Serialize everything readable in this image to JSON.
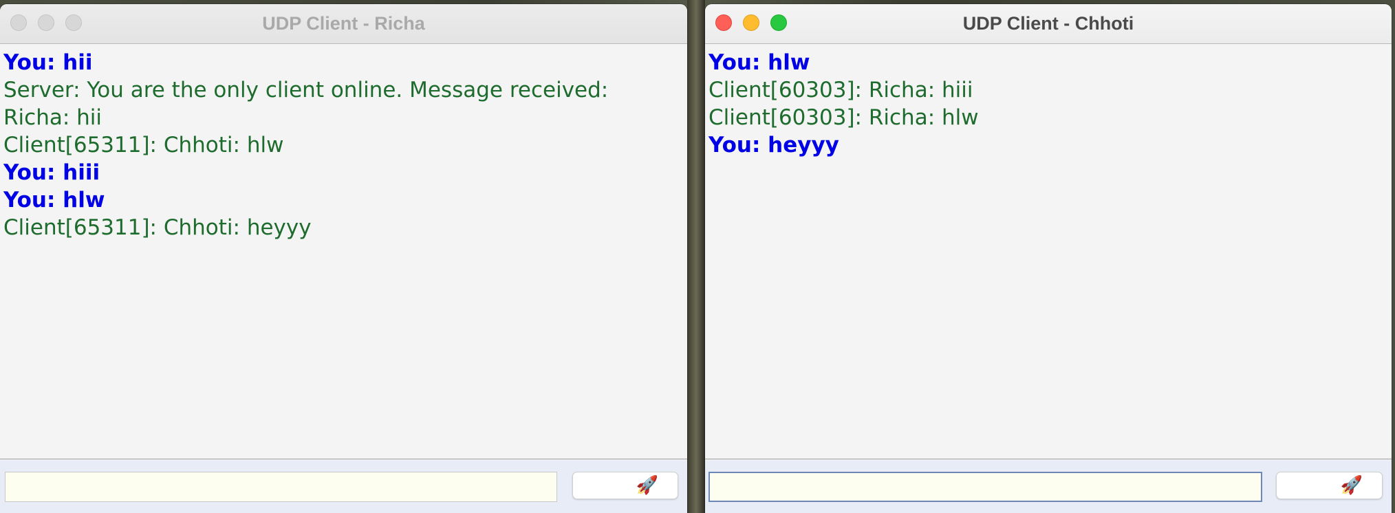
{
  "windows": [
    {
      "title": "UDP Client - Richa",
      "state": "inactive",
      "messages": [
        {
          "text": "You: hii",
          "from_self": true
        },
        {
          "text": "Server: You are the only client online. Message received:",
          "from_self": false
        },
        {
          "text": "Richa: hii",
          "from_self": false
        },
        {
          "text": "Client[65311]: Chhoti: hlw",
          "from_self": false
        },
        {
          "text": "You: hiii",
          "from_self": true
        },
        {
          "text": "You: hlw",
          "from_self": true
        },
        {
          "text": "Client[65311]: Chhoti: heyyy",
          "from_self": false
        }
      ],
      "input": {
        "value": "",
        "placeholder": ""
      },
      "send_button": {
        "icon": "rocket-icon",
        "glyph": "🚀"
      }
    },
    {
      "title": "UDP Client - Chhoti",
      "state": "active",
      "messages": [
        {
          "text": "You: hlw",
          "from_self": true
        },
        {
          "text": "Client[60303]: Richa: hiii",
          "from_self": false
        },
        {
          "text": "Client[60303]: Richa: hlw",
          "from_self": false
        },
        {
          "text": "You: heyyy",
          "from_self": true
        }
      ],
      "input": {
        "value": "",
        "placeholder": ""
      },
      "send_button": {
        "icon": "rocket-icon",
        "glyph": "🚀"
      }
    }
  ],
  "colors": {
    "self_message": "#0000e6",
    "other_message": "#1e6b2e",
    "chat_background": "#f4f4f4",
    "input_background": "#fdfdf0",
    "close_button": "#fe5f57",
    "minimize_button": "#febc2e",
    "zoom_button": "#28c840"
  }
}
